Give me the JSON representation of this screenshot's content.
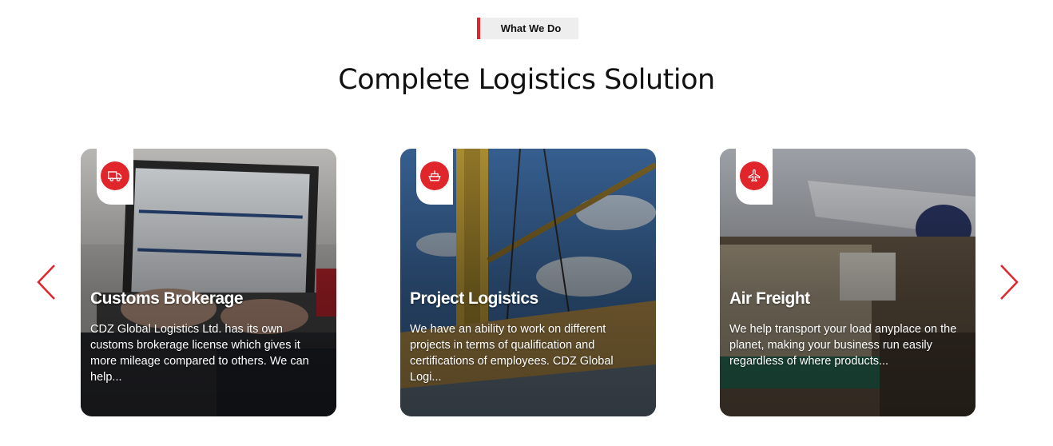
{
  "section": {
    "eyebrow": "What We Do",
    "title": "Complete Logistics Solution"
  },
  "carousel": {
    "prev_icon": "chevron-left-icon",
    "next_icon": "chevron-right-icon",
    "accent_color": "#e0252b",
    "cards": [
      {
        "icon": "truck-icon",
        "title": "Customs Brokerage",
        "text": "CDZ Global Logistics Ltd. has its own customs brokerage license which gives it more mileage compared to others. We can help..."
      },
      {
        "icon": "ship-icon",
        "title": "Project Logistics",
        "text": "We have an ability to work on different projects in terms of qualification and certifications of employees. CDZ Global Logi..."
      },
      {
        "icon": "airplane-icon",
        "title": "Air Freight",
        "text": "We help transport your load anyplace on the planet, making your business run easily regardless of where products..."
      }
    ]
  }
}
